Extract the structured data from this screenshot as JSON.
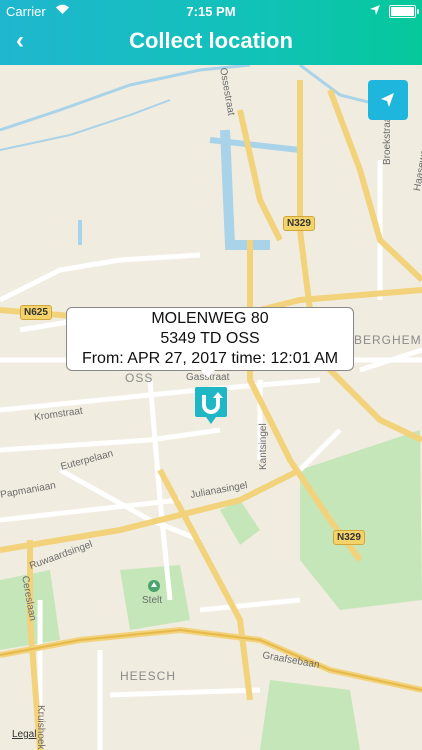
{
  "status_bar": {
    "carrier": "Carrier",
    "time": "7:15 PM"
  },
  "header": {
    "back_icon": "‹",
    "title": "Collect location"
  },
  "map": {
    "road_shields": [
      "N329",
      "N625",
      "N329"
    ],
    "street_labels": [
      "Ossestraat",
      "Broekstraat",
      "Gasstraat",
      "Kromstraat",
      "Euterpelaan",
      "Kantsingel",
      "Julianasingel",
      "Ruwaardsingel",
      "Cereslaan",
      "Kruishoek",
      "Graafsebaan",
      "Haaseweg",
      "Papmaniaan"
    ],
    "place_labels": {
      "oss": "OSS",
      "berghem": "BERGHEM",
      "heesch": "HEESCH",
      "stelt": "Stelt"
    },
    "legal": "Legal"
  },
  "callout": {
    "line1": "MOLENWEG 80",
    "line2": "5349 TD OSS",
    "line3": "From: APR 27, 2017 time: 12:01 AM"
  },
  "icons": {
    "back": "chevron-left-icon",
    "locate": "navigation-arrow-icon",
    "pin": "u-marker-icon"
  },
  "colors": {
    "header_start": "#1fb6cf",
    "header_end": "#05c89a",
    "locate_button": "#1fb6dd",
    "pin": "#1fb6c5"
  }
}
